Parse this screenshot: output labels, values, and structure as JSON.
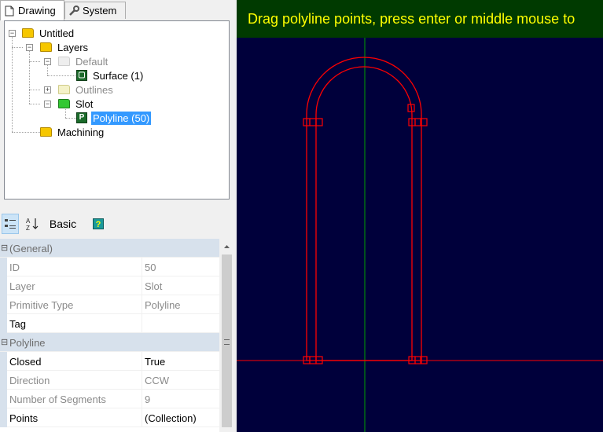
{
  "tabs": [
    {
      "label": "Drawing",
      "icon": "document-icon"
    },
    {
      "label": "System",
      "icon": "wrench-icon"
    }
  ],
  "tree": {
    "root": "Untitled",
    "layers": "Layers",
    "default": "Default",
    "surface": "Surface (1)",
    "outlines": "Outlines",
    "slot": "Slot",
    "polyline": "Polyline (50)",
    "machining": "Machining"
  },
  "toolbar": {
    "basic_label": "Basic"
  },
  "properties": {
    "general_category": "(General)",
    "polyline_category": "Polyline",
    "rows": [
      {
        "key": "ID",
        "value": "50"
      },
      {
        "key": "Layer",
        "value": "Slot"
      },
      {
        "key": "Primitive Type",
        "value": "Polyline"
      },
      {
        "key": "Tag",
        "value": ""
      },
      {
        "key": "Closed",
        "value": "True"
      },
      {
        "key": "Direction",
        "value": "CCW"
      },
      {
        "key": "Number of Segments",
        "value": "9"
      },
      {
        "key": "Points",
        "value": "(Collection)"
      }
    ]
  },
  "canvas": {
    "hint": "Drag polyline points, press enter or middle mouse to",
    "colors": {
      "background": "#00003b",
      "hint_bar": "#003a00",
      "hint_text": "#ffff00",
      "shape": "#ff0000",
      "axis_x": "#ff0000",
      "axis_y": "#00a000"
    }
  }
}
